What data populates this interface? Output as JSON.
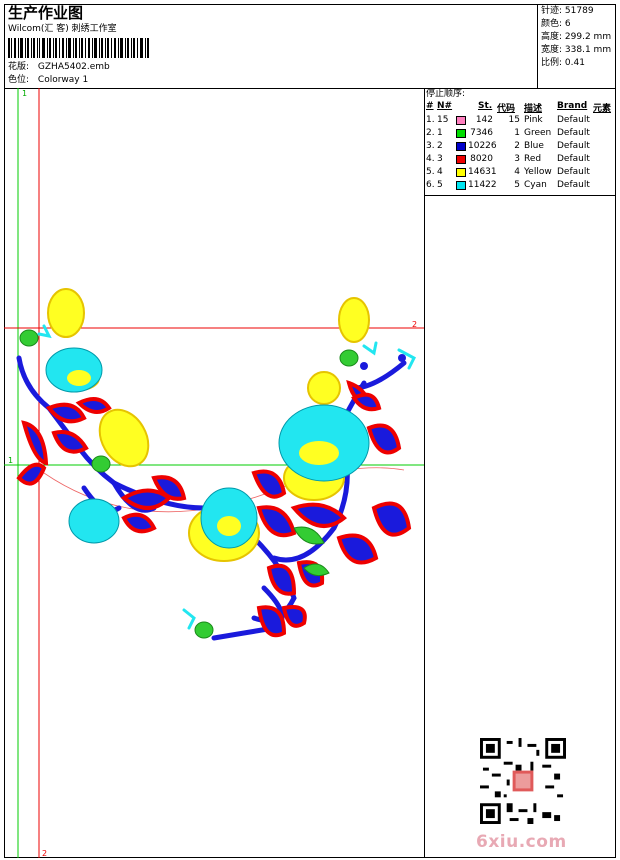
{
  "header": {
    "title": "生产作业图",
    "studio": "Wilcom(汇 客) 刺绣工作室",
    "design_label": "花版:",
    "design_file": "GZHA5402.emb",
    "colorway_label": "色位:",
    "colorway": "Colorway 1"
  },
  "stats": [
    {
      "label": "针迹:",
      "value": "51789"
    },
    {
      "label": "颜色:",
      "value": "6"
    },
    {
      "label": "高度:",
      "value": "299.2 mm"
    },
    {
      "label": "宽度:",
      "value": "338.1 mm"
    },
    {
      "label": "比例:",
      "value": "0.41"
    }
  ],
  "guides": {
    "vertical_green": "1",
    "horizontal_green": "1",
    "horizontal_red": "2",
    "vertical_red": "2"
  },
  "stop_sequence": {
    "title": "停止顺序:",
    "columns": {
      "index": "#",
      "no": "N#",
      "stitches": "St.",
      "code": "代码",
      "desc": "描述",
      "brand": "Brand",
      "element": "元素"
    },
    "rows": [
      {
        "index": "1.",
        "no": "15",
        "color": "#ff7fbf",
        "stitches": "142",
        "code": "15",
        "desc": "Pink",
        "brand": "Default"
      },
      {
        "index": "2.",
        "no": "1",
        "color": "#00dd00",
        "stitches": "7346",
        "code": "1",
        "desc": "Green",
        "brand": "Default"
      },
      {
        "index": "3.",
        "no": "2",
        "color": "#0000cc",
        "stitches": "10226",
        "code": "2",
        "desc": "Blue",
        "brand": "Default"
      },
      {
        "index": "4.",
        "no": "3",
        "color": "#ee0000",
        "stitches": "8020",
        "code": "3",
        "desc": "Red",
        "brand": "Default"
      },
      {
        "index": "5.",
        "no": "4",
        "color": "#ffff00",
        "stitches": "14631",
        "code": "4",
        "desc": "Yellow",
        "brand": "Default"
      },
      {
        "index": "6.",
        "no": "5",
        "color": "#00e5f0",
        "stitches": "11422",
        "code": "5",
        "desc": "Cyan",
        "brand": "Default"
      }
    ]
  },
  "watermark": "6xiu.com"
}
